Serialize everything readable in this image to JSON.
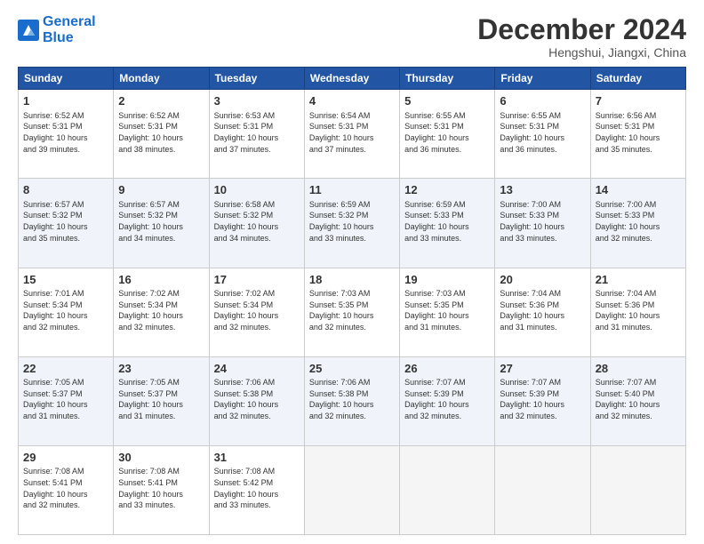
{
  "logo": {
    "line1": "General",
    "line2": "Blue"
  },
  "title": "December 2024",
  "subtitle": "Hengshui, Jiangxi, China",
  "days_of_week": [
    "Sunday",
    "Monday",
    "Tuesday",
    "Wednesday",
    "Thursday",
    "Friday",
    "Saturday"
  ],
  "weeks": [
    [
      {
        "day": "1",
        "info": "Sunrise: 6:52 AM\nSunset: 5:31 PM\nDaylight: 10 hours\nand 39 minutes."
      },
      {
        "day": "2",
        "info": "Sunrise: 6:52 AM\nSunset: 5:31 PM\nDaylight: 10 hours\nand 38 minutes."
      },
      {
        "day": "3",
        "info": "Sunrise: 6:53 AM\nSunset: 5:31 PM\nDaylight: 10 hours\nand 37 minutes."
      },
      {
        "day": "4",
        "info": "Sunrise: 6:54 AM\nSunset: 5:31 PM\nDaylight: 10 hours\nand 37 minutes."
      },
      {
        "day": "5",
        "info": "Sunrise: 6:55 AM\nSunset: 5:31 PM\nDaylight: 10 hours\nand 36 minutes."
      },
      {
        "day": "6",
        "info": "Sunrise: 6:55 AM\nSunset: 5:31 PM\nDaylight: 10 hours\nand 36 minutes."
      },
      {
        "day": "7",
        "info": "Sunrise: 6:56 AM\nSunset: 5:31 PM\nDaylight: 10 hours\nand 35 minutes."
      }
    ],
    [
      {
        "day": "8",
        "info": "Sunrise: 6:57 AM\nSunset: 5:32 PM\nDaylight: 10 hours\nand 35 minutes."
      },
      {
        "day": "9",
        "info": "Sunrise: 6:57 AM\nSunset: 5:32 PM\nDaylight: 10 hours\nand 34 minutes."
      },
      {
        "day": "10",
        "info": "Sunrise: 6:58 AM\nSunset: 5:32 PM\nDaylight: 10 hours\nand 34 minutes."
      },
      {
        "day": "11",
        "info": "Sunrise: 6:59 AM\nSunset: 5:32 PM\nDaylight: 10 hours\nand 33 minutes."
      },
      {
        "day": "12",
        "info": "Sunrise: 6:59 AM\nSunset: 5:33 PM\nDaylight: 10 hours\nand 33 minutes."
      },
      {
        "day": "13",
        "info": "Sunrise: 7:00 AM\nSunset: 5:33 PM\nDaylight: 10 hours\nand 33 minutes."
      },
      {
        "day": "14",
        "info": "Sunrise: 7:00 AM\nSunset: 5:33 PM\nDaylight: 10 hours\nand 32 minutes."
      }
    ],
    [
      {
        "day": "15",
        "info": "Sunrise: 7:01 AM\nSunset: 5:34 PM\nDaylight: 10 hours\nand 32 minutes."
      },
      {
        "day": "16",
        "info": "Sunrise: 7:02 AM\nSunset: 5:34 PM\nDaylight: 10 hours\nand 32 minutes."
      },
      {
        "day": "17",
        "info": "Sunrise: 7:02 AM\nSunset: 5:34 PM\nDaylight: 10 hours\nand 32 minutes."
      },
      {
        "day": "18",
        "info": "Sunrise: 7:03 AM\nSunset: 5:35 PM\nDaylight: 10 hours\nand 32 minutes."
      },
      {
        "day": "19",
        "info": "Sunrise: 7:03 AM\nSunset: 5:35 PM\nDaylight: 10 hours\nand 31 minutes."
      },
      {
        "day": "20",
        "info": "Sunrise: 7:04 AM\nSunset: 5:36 PM\nDaylight: 10 hours\nand 31 minutes."
      },
      {
        "day": "21",
        "info": "Sunrise: 7:04 AM\nSunset: 5:36 PM\nDaylight: 10 hours\nand 31 minutes."
      }
    ],
    [
      {
        "day": "22",
        "info": "Sunrise: 7:05 AM\nSunset: 5:37 PM\nDaylight: 10 hours\nand 31 minutes."
      },
      {
        "day": "23",
        "info": "Sunrise: 7:05 AM\nSunset: 5:37 PM\nDaylight: 10 hours\nand 31 minutes."
      },
      {
        "day": "24",
        "info": "Sunrise: 7:06 AM\nSunset: 5:38 PM\nDaylight: 10 hours\nand 32 minutes."
      },
      {
        "day": "25",
        "info": "Sunrise: 7:06 AM\nSunset: 5:38 PM\nDaylight: 10 hours\nand 32 minutes."
      },
      {
        "day": "26",
        "info": "Sunrise: 7:07 AM\nSunset: 5:39 PM\nDaylight: 10 hours\nand 32 minutes."
      },
      {
        "day": "27",
        "info": "Sunrise: 7:07 AM\nSunset: 5:39 PM\nDaylight: 10 hours\nand 32 minutes."
      },
      {
        "day": "28",
        "info": "Sunrise: 7:07 AM\nSunset: 5:40 PM\nDaylight: 10 hours\nand 32 minutes."
      }
    ],
    [
      {
        "day": "29",
        "info": "Sunrise: 7:08 AM\nSunset: 5:41 PM\nDaylight: 10 hours\nand 32 minutes."
      },
      {
        "day": "30",
        "info": "Sunrise: 7:08 AM\nSunset: 5:41 PM\nDaylight: 10 hours\nand 33 minutes."
      },
      {
        "day": "31",
        "info": "Sunrise: 7:08 AM\nSunset: 5:42 PM\nDaylight: 10 hours\nand 33 minutes."
      },
      {
        "day": "",
        "info": ""
      },
      {
        "day": "",
        "info": ""
      },
      {
        "day": "",
        "info": ""
      },
      {
        "day": "",
        "info": ""
      }
    ]
  ]
}
